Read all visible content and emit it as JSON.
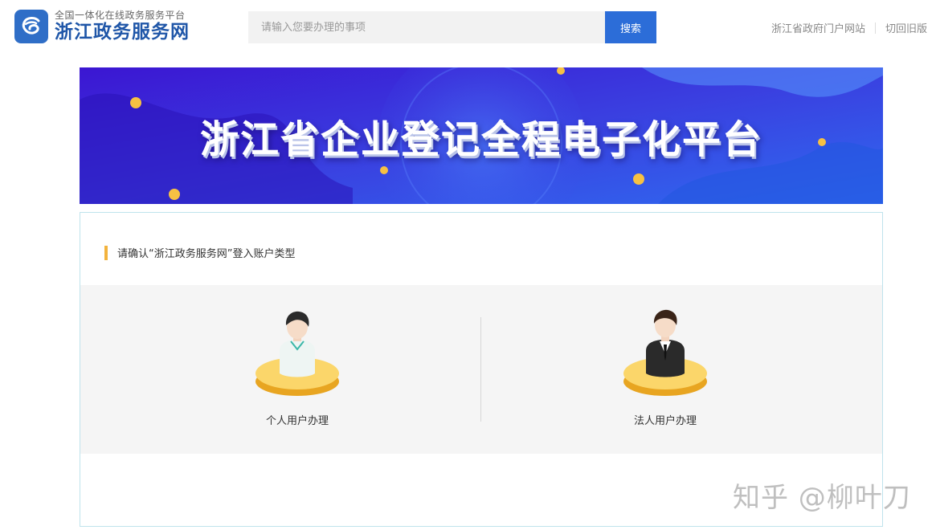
{
  "header": {
    "logo_subtitle": "全国一体化在线政务服务平台",
    "logo_title": "浙江政务服务网",
    "search_placeholder": "请输入您要办理的事项",
    "search_button": "搜索",
    "links": [
      "浙江省政府门户网站",
      "切回旧版"
    ]
  },
  "banner": {
    "title": "浙江省企业登记全程电子化平台"
  },
  "panel": {
    "title": "请确认“浙江政务服务网”登入账户类型",
    "options": [
      {
        "label": "个人用户办理",
        "icon": "person-casual-icon"
      },
      {
        "label": "法人用户办理",
        "icon": "person-suit-icon"
      }
    ]
  },
  "watermark": "知乎 @柳叶刀",
  "colors": {
    "brand_blue": "#2c6dd8",
    "accent_yellow": "#f3b33d",
    "banner_purple": "#3a1fd6"
  }
}
